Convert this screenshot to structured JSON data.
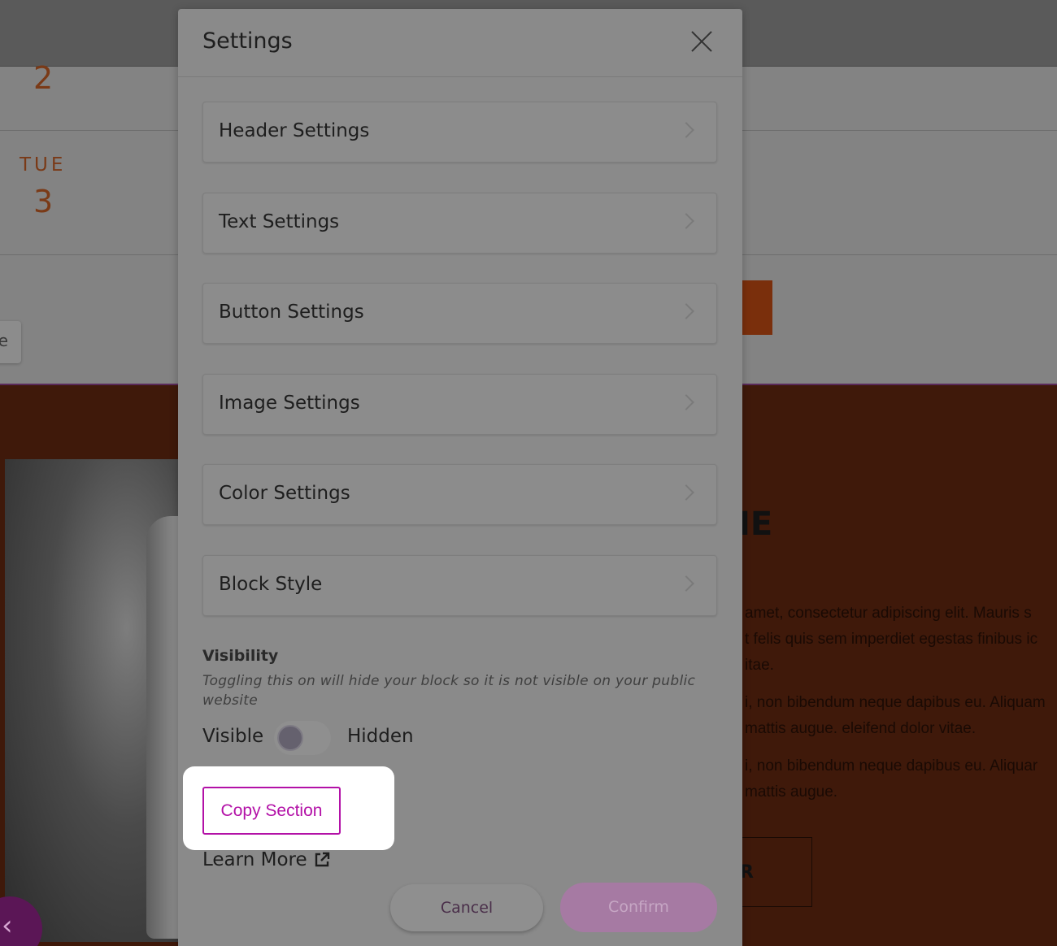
{
  "background": {
    "calendar": {
      "day1_number": "2",
      "day2_name": "TUE",
      "day2_number": "3"
    },
    "left_tab_text": "e",
    "hero": {
      "heading_fragment": "IE",
      "paragraph_lines": [
        "amet, consectetur adipiscing elit. Mauris s",
        "t felis quis sem imperdiet egestas finibus ic",
        "itae.",
        "i, non bibendum neque dapibus eu. Aliquam",
        "mattis augue. eleifend dolor vitae.",
        "i, non bibendum neque dapibus eu. Aliquar",
        "mattis augue."
      ],
      "outline_button_fragment": "R"
    }
  },
  "modal": {
    "title": "Settings",
    "settings_items": [
      {
        "label": "Header Settings"
      },
      {
        "label": "Text Settings"
      },
      {
        "label": "Button Settings"
      },
      {
        "label": "Image Settings"
      },
      {
        "label": "Color Settings"
      },
      {
        "label": "Block Style"
      }
    ],
    "visibility": {
      "title": "Visibility",
      "description": "Toggling this on will hide your block so it is not visible on your public website",
      "visible_label": "Visible",
      "hidden_label": "Hidden",
      "is_hidden": false
    },
    "copy_section_label": "Copy Section",
    "learn_more_label": "Learn More",
    "cancel_label": "Cancel",
    "confirm_label": "Confirm"
  },
  "colors": {
    "accent": "#b311a7",
    "hero_bg": "#3f190a",
    "overlay": "#8a8a8a"
  }
}
